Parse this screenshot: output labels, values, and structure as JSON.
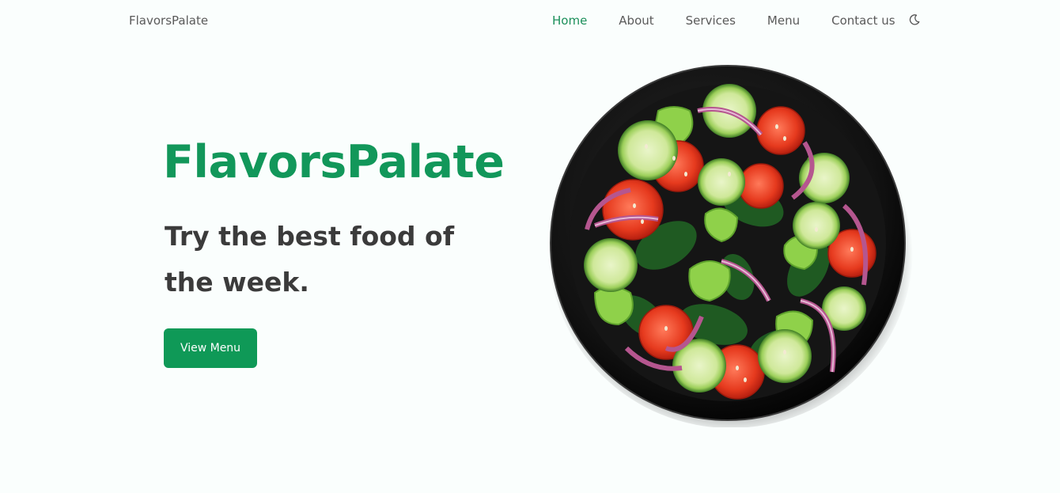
{
  "brand": {
    "name": "FlavorsPalate"
  },
  "nav": {
    "items": [
      {
        "label": "Home",
        "active": true
      },
      {
        "label": "About",
        "active": false
      },
      {
        "label": "Services",
        "active": false
      },
      {
        "label": "Menu",
        "active": false
      },
      {
        "label": "Contact us",
        "active": false
      }
    ],
    "theme_toggle_icon": "moon-icon"
  },
  "hero": {
    "title": "FlavorsPalate",
    "subtitle": "Try the best food of the week.",
    "cta_label": "View Menu",
    "image_icon": "salad-bowl-image"
  },
  "colors": {
    "accent": "#0f9957",
    "title": "#12975a",
    "active_nav": "#1b8f5a",
    "text": "#3b3b3b",
    "background": "#fafefd"
  }
}
